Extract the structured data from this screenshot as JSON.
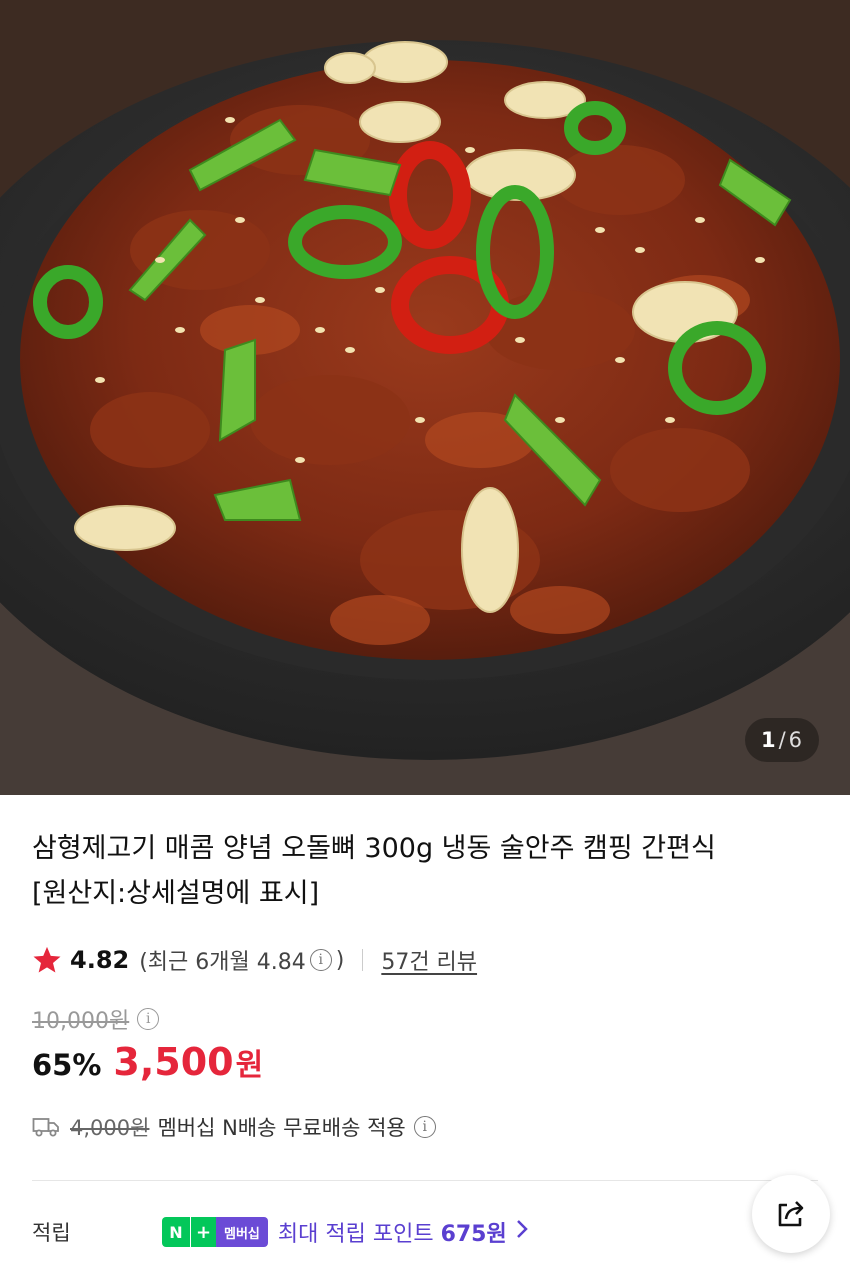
{
  "gallery": {
    "current": "1",
    "separator": "/",
    "total": "6"
  },
  "product": {
    "title_line1": "삼형제고기 매콤 양념 오돌뼈 300g 냉동 술안주 캠핑 간편식",
    "title_line2": "[원산지:상세설명에 표시]"
  },
  "rating": {
    "score": "4.82",
    "recent_prefix": "(최근 6개월 4.84",
    "recent_suffix": ")",
    "reviews_label": "57건 리뷰"
  },
  "price": {
    "original": "10,000원",
    "discount": "65%",
    "sale": "3,500",
    "currency": "원"
  },
  "shipping": {
    "original_fee": "4,000원",
    "text": "멤버십 N배송 무료배송 적용"
  },
  "points": {
    "label": "적립",
    "badge_n": "N",
    "badge_plus": "+",
    "badge_membership": "멤버십",
    "text_prefix": "최대 적립 포인트 ",
    "amount": "675원"
  },
  "colors": {
    "sale_red": "#e5263b",
    "points_purple": "#5a3fd0",
    "naver_green": "#03c75a",
    "star": "#e5263b"
  },
  "icons": [
    "star-icon",
    "info-icon",
    "truck-icon",
    "chevron-right-icon",
    "share-icon"
  ]
}
